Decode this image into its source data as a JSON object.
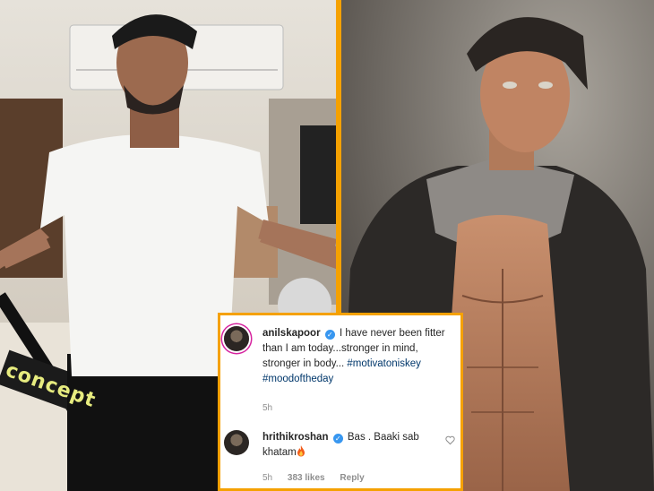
{
  "theme": {
    "accent": "#f5a100"
  },
  "left_photo": {
    "brand_text": "concept"
  },
  "comments": [
    {
      "username": "anilskapoor",
      "text_parts": [
        "I have never been fitter than I am today...stronger in mind, stronger in body... "
      ],
      "hashtags": [
        "#motivatoniskey",
        "#moodoftheday"
      ],
      "time": "5h",
      "icon": "verified-badge-icon"
    },
    {
      "username": "hrithikroshan",
      "text": "Bas . Baaki sab khatam",
      "emoji_icon": "fire-icon",
      "time": "5h",
      "likes": "383 likes",
      "reply_label": "Reply",
      "icon": "heart-outline-icon"
    }
  ]
}
